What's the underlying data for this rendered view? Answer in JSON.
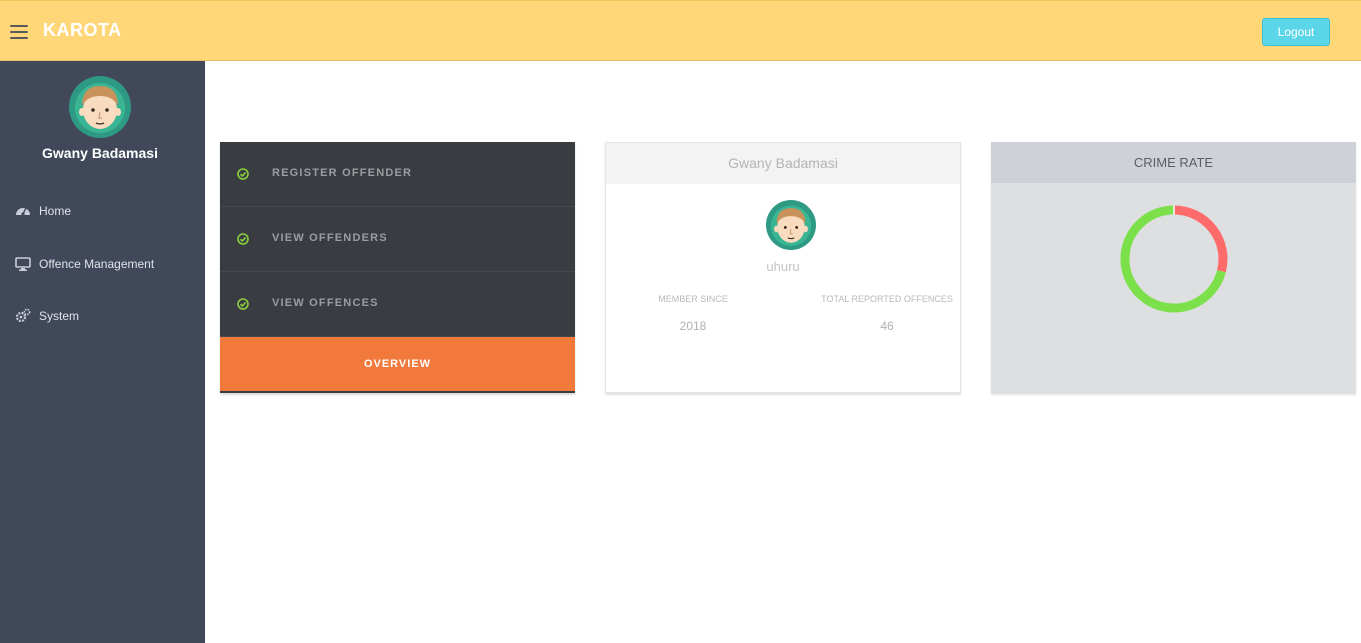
{
  "header": {
    "brand": "KAROTA",
    "logout_label": "Logout",
    "accent_color": "#ffd779"
  },
  "sidebar": {
    "user_name": "Gwany Badamasi",
    "items": [
      {
        "label": "Home",
        "icon": "dashboard-icon"
      },
      {
        "label": "Offence Management",
        "icon": "monitor-icon"
      },
      {
        "label": "System",
        "icon": "cogs-icon"
      }
    ]
  },
  "menu": {
    "items": [
      {
        "label": "REGISTER OFFENDER",
        "icon": "check-circle-icon"
      },
      {
        "label": "VIEW OFFENDERS",
        "icon": "check-circle-icon"
      },
      {
        "label": "VIEW OFFENCES",
        "icon": "check-circle-icon"
      }
    ],
    "overview_label": "OVERVIEW",
    "overview_color": "#f0793b"
  },
  "profile": {
    "title": "Gwany Badamasi",
    "username": "uhuru",
    "member_since_label": "MEMBER SINCE",
    "member_since_value": "2018",
    "offences_label": "TOTAL REPORTED OFFENCES",
    "offences_value": "46"
  },
  "crime": {
    "title": "CRIME RATE",
    "chart_data": {
      "type": "pie",
      "style": "donut",
      "values": [
        29,
        71
      ],
      "colors": [
        "#ff6b6b",
        "#7ce04a"
      ]
    }
  }
}
